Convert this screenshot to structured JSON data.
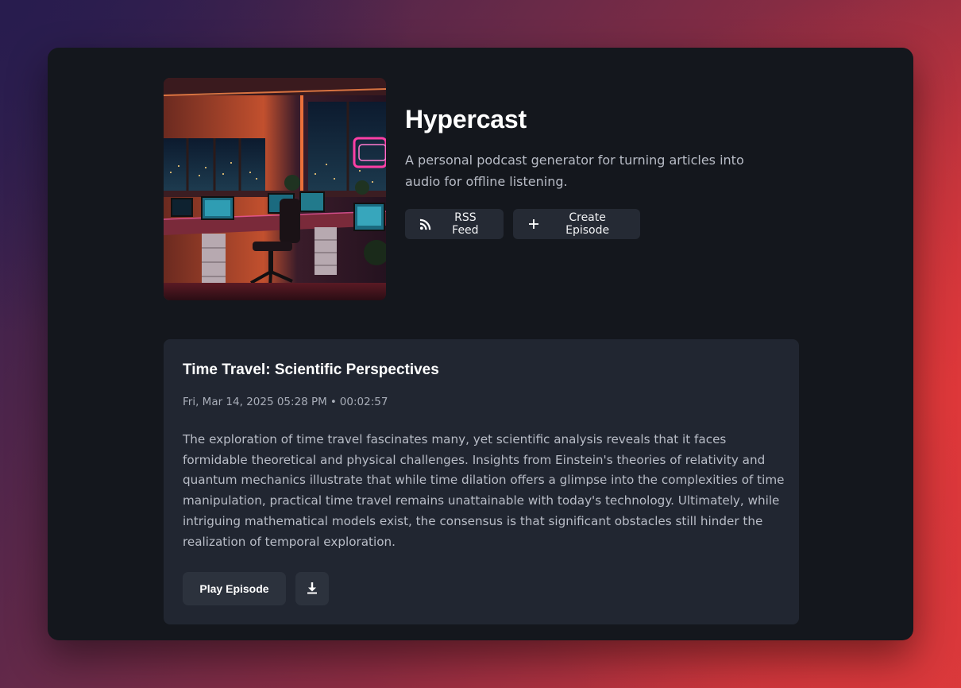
{
  "podcast": {
    "title": "Hypercast",
    "description": "A personal podcast generator for turning articles into audio for offline listening.",
    "cover_image": "neon-lit-office-desk-cover",
    "buttons": {
      "rss_label": "RSS Feed",
      "create_label": "Create Episode"
    }
  },
  "episode": {
    "title": "Time Travel: Scientific Perspectives",
    "date": "Fri, Mar 14, 2025 05:28 PM",
    "separator": "•",
    "duration": "00:02:57",
    "description": "The exploration of time travel fascinates many, yet scientific analysis reveals that it faces formidable theoretical and physical challenges. Insights from Einstein's theories of relativity and quantum mechanics illustrate that while time dilation offers a glimpse into the complexities of time manipulation, practical time travel remains unattainable with today's technology. Ultimately, while intriguing mathematical models exist, the consensus is that significant obstacles still hinder the realization of temporal exploration.",
    "play_label": "Play Episode",
    "download_icon": "download-icon"
  },
  "icons": {
    "rss": "rss-icon",
    "plus": "plus-icon"
  },
  "colors": {
    "panel": "#14171d",
    "card": "#212631",
    "button": "#252a34",
    "neon_pink": "#ff3fa6",
    "neon_orange": "#ff7a3c"
  }
}
